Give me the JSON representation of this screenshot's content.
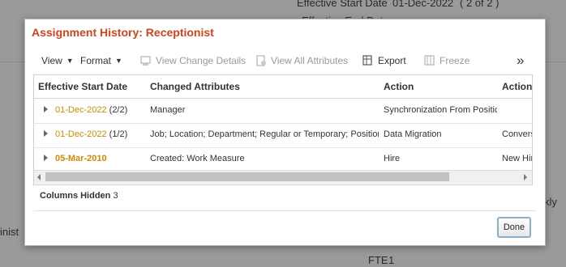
{
  "background": {
    "effective_start_label": "Effective Start Date",
    "effective_start_value": "01-Dec-2022",
    "version_badge": "( 2 of 2 )",
    "effective_end_label": "Effective End Date",
    "left_partial": "inist",
    "right_partial": "kly",
    "fte_label": "FTE",
    "fte_value": "1"
  },
  "dialog": {
    "title": "Assignment History: Receptionist",
    "toolbar": {
      "view": "View",
      "format": "Format",
      "view_change_details": "View Change Details",
      "view_all_attributes": "View All Attributes",
      "export": "Export",
      "freeze": "Freeze",
      "more": "»"
    },
    "table": {
      "headers": [
        "Effective Start Date",
        "Changed Attributes",
        "Action",
        "Action"
      ],
      "rows": [
        {
          "date": "01-Dec-2022",
          "count": "(2/2)",
          "changed": "Manager",
          "action": "Synchronization From Positic",
          "action_reason": ""
        },
        {
          "date": "01-Dec-2022",
          "count": "(1/2)",
          "changed": "Job; Location; Department; Regular or Temporary; Position",
          "action": "Data Migration",
          "action_reason": "Convers"
        },
        {
          "date": "05-Mar-2010",
          "count": "",
          "changed": "Created: Work Measure",
          "action": "Hire",
          "action_reason": "New Hir"
        }
      ]
    },
    "columns_hidden_label": "Columns Hidden",
    "columns_hidden_value": "3",
    "done_label": "Done"
  },
  "colors": {
    "title": "#d0451b",
    "date_link": "#d08a00"
  }
}
